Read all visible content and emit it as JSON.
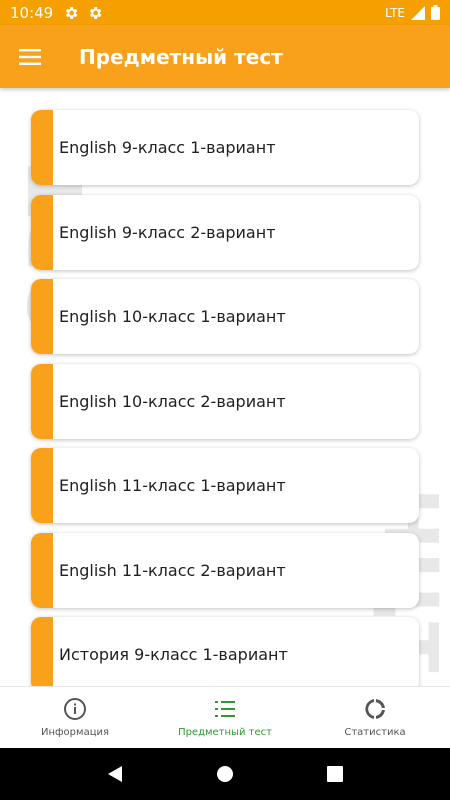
{
  "status_bar": {
    "time": "10:49",
    "network": "LTE"
  },
  "app_bar": {
    "title": "Предметный тест"
  },
  "watermark": {
    "left_text": "ОРТ",
    "right_text": "НЦТ"
  },
  "tests": [
    {
      "label": "English 9-класс 1-вариант"
    },
    {
      "label": "English 9-класс 2-вариант"
    },
    {
      "label": "English 10-класс 1-вариант"
    },
    {
      "label": "English 10-класс 2-вариант"
    },
    {
      "label": "English 11-класс 1-вариант"
    },
    {
      "label": "English 11-класс 2-вариант"
    },
    {
      "label": "История 9-класс 1-вариант"
    }
  ],
  "bottom_nav": {
    "items": [
      {
        "label": "Информация",
        "icon": "info-icon",
        "active": false
      },
      {
        "label": "Предметный тест",
        "icon": "list-icon",
        "active": true
      },
      {
        "label": "Статистика",
        "icon": "stats-icon",
        "active": false
      }
    ]
  },
  "colors": {
    "primary": "#f9a11b",
    "status_bar": "#f59f00",
    "active_nav": "#2e9a2e"
  }
}
